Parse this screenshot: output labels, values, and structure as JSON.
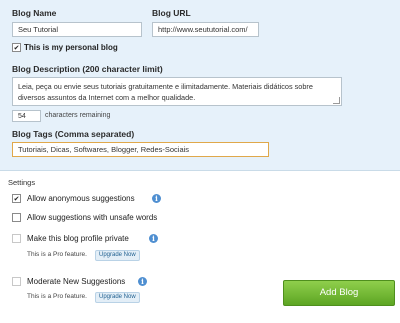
{
  "form": {
    "blog_name_label": "Blog Name",
    "blog_name_value": "Seu Tutorial",
    "blog_url_label": "Blog URL",
    "blog_url_value": "http://www.seututorial.com/",
    "personal_blog_label": "This is my personal blog",
    "personal_blog_checked": true,
    "description_label": "Blog Description (200 character limit)",
    "description_value": "Leia, peça ou envie seus tutoriais gratuitamente e ilimitadamente. Materiais didáticos sobre diversos assuntos da Internet com a melhor qualidade.",
    "chars_remaining_value": "54",
    "chars_remaining_label": "characters remaining",
    "tags_label": "Blog Tags (Comma separated)",
    "tags_value": "Tutoriais, Dicas, Softwares, Blogger, Redes-Sociais"
  },
  "settings": {
    "title": "Settings",
    "anonymous_label": "Allow anonymous suggestions",
    "anonymous_checked": true,
    "unsafe_label": "Allow suggestions with unsafe words",
    "unsafe_checked": false,
    "private_label": "Make this blog profile private",
    "private_note": "This is a Pro feature.",
    "private_upgrade": "Upgrade Now",
    "moderate_label": "Moderate New Suggestions",
    "moderate_note": "This is a Pro feature.",
    "moderate_upgrade": "Upgrade Now"
  },
  "actions": {
    "add_blog_label": "Add Blog"
  },
  "icons": {
    "info": "info-icon",
    "check": "checkmark-icon"
  },
  "colors": {
    "panel_bg": "#e6f1fa",
    "button_green": "#6db32f",
    "info_blue": "#4f8fd1",
    "tags_border": "#e0a84a"
  }
}
